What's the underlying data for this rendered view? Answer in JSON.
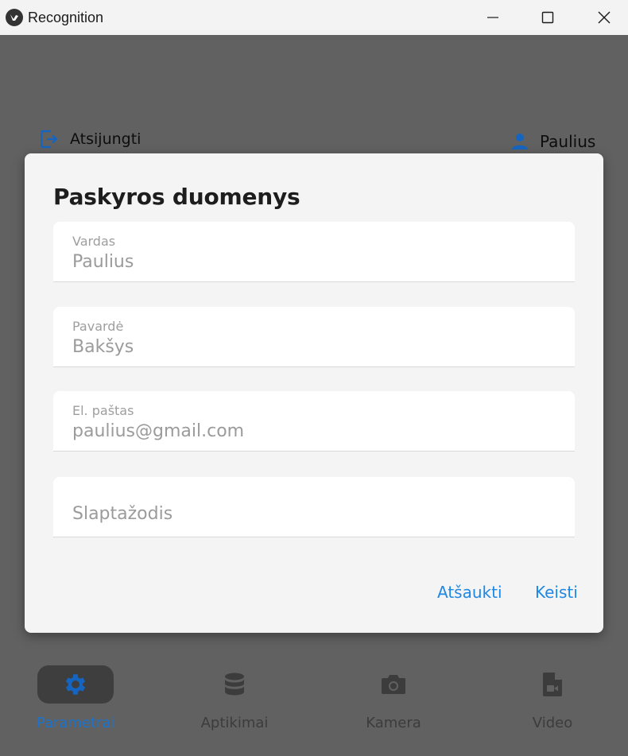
{
  "window": {
    "title": "Recognition"
  },
  "header": {
    "logout_label": "Atsijungti",
    "user_name": "Paulius"
  },
  "dialog": {
    "title": "Paskyros duomenys",
    "fields": [
      {
        "label": "Vardas",
        "value": "Paulius"
      },
      {
        "label": "Pavardė",
        "value": "Bakšys"
      },
      {
        "label": "El. paštas",
        "value": "paulius@gmail.com"
      },
      {
        "label": "",
        "placeholder": "Slaptažodis"
      }
    ],
    "cancel_label": "Atšaukti",
    "confirm_label": "Keisti"
  },
  "bottom_nav": {
    "items": [
      {
        "label": "Parametrai",
        "icon": "gear-icon",
        "active": true
      },
      {
        "label": "Aptikimai",
        "icon": "database-icon",
        "active": false
      },
      {
        "label": "Kamera",
        "icon": "camera-icon",
        "active": false
      },
      {
        "label": "Video",
        "icon": "video-file-icon",
        "active": false
      }
    ]
  },
  "colors": {
    "accent": "#1e88e5",
    "active_nav": "#1e73c8",
    "overlay": "#616161",
    "dialog_bg": "#f4f4f4"
  }
}
